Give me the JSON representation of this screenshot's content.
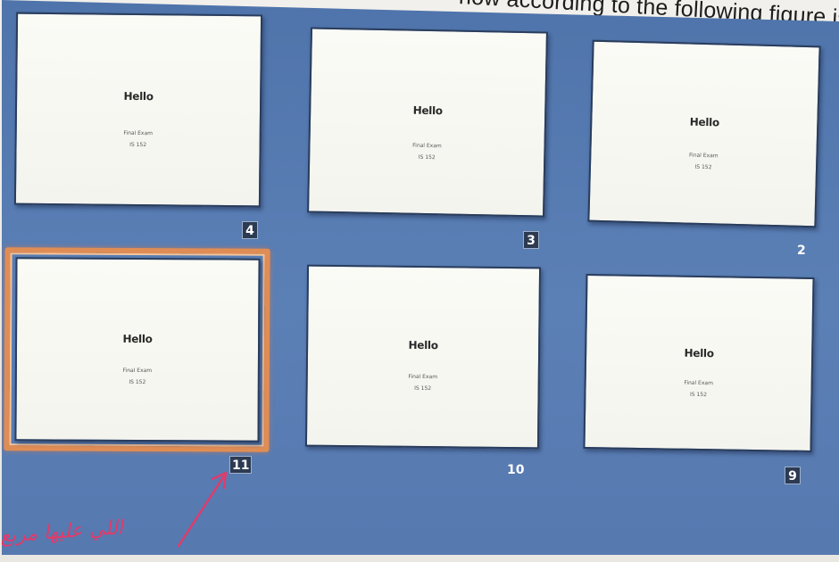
{
  "question_fragment": "how according to the following figure is",
  "slide_content": {
    "title": "Hello",
    "line1": "Final Exam",
    "line2": "IS 152"
  },
  "slides": [
    {
      "number": "4",
      "selected": false
    },
    {
      "number": "3",
      "selected": false
    },
    {
      "number": "2",
      "selected": false
    },
    {
      "number": "11",
      "selected": true
    },
    {
      "number": "10",
      "selected": false
    },
    {
      "number": "9",
      "selected": false
    }
  ],
  "handwritten_annotation": "اللي عليها مربع",
  "colors": {
    "sorter_background": "#5679b0",
    "selection_border": "#e08d55",
    "annotation_ink": "#e23a6a"
  }
}
